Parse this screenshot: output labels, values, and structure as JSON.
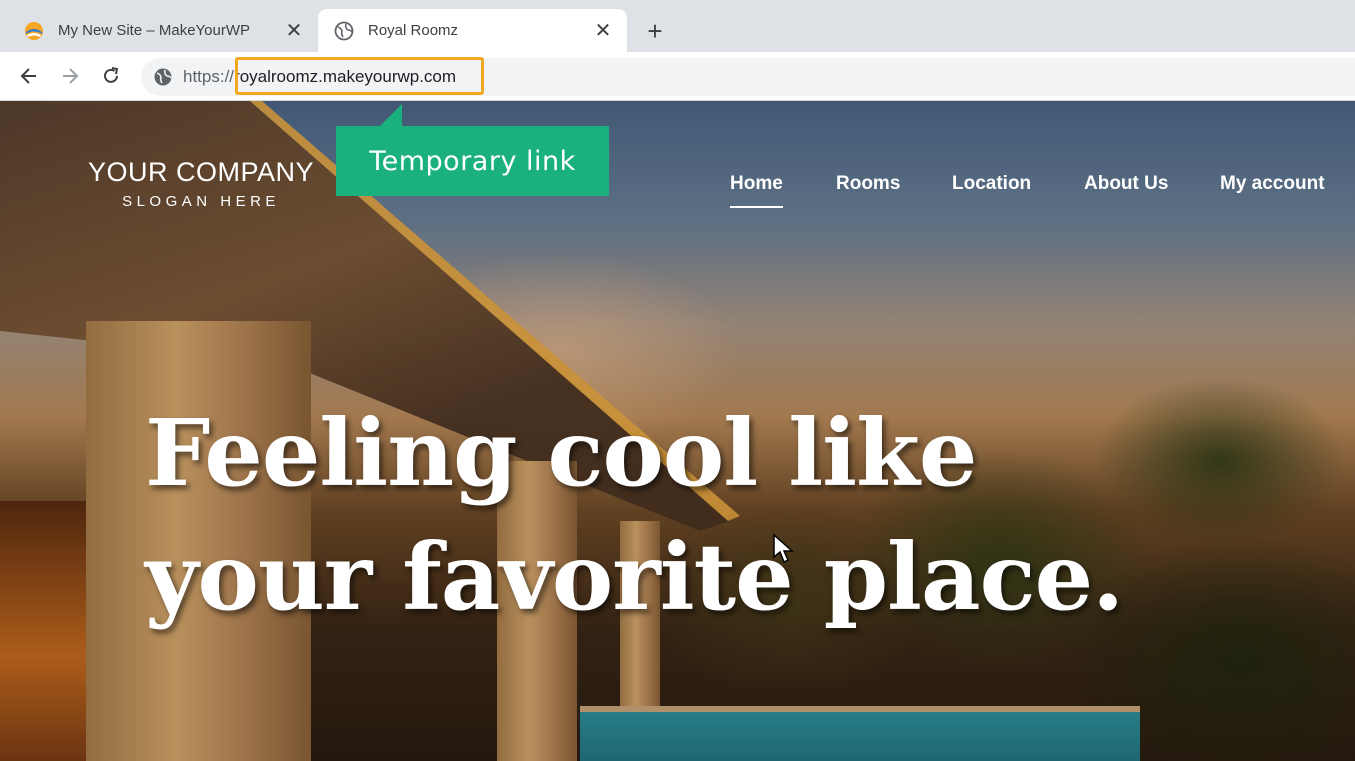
{
  "browser": {
    "tabs": [
      {
        "title": "My New Site – MakeYourWP",
        "active": false,
        "favicon": "makeyourwp-logo"
      },
      {
        "title": "Royal Roomz",
        "active": true,
        "favicon": "globe-icon"
      }
    ],
    "close_glyph": "✕",
    "new_tab_glyph": "+",
    "url_scheme": "https://",
    "url_host": "royalroomz.makeyourwp.com"
  },
  "annotation": {
    "callout_text": "Temporary link",
    "highlight_color": "#f3a81e",
    "callout_color": "#1bb17e"
  },
  "site": {
    "logo_name": "YOUR COMPANY",
    "logo_slogan": "SLOGAN HERE",
    "nav": [
      "Home",
      "Rooms",
      "Location",
      "About Us",
      "My account"
    ],
    "active_nav": "Home",
    "hero_line1": "Feeling cool like",
    "hero_line2": "your favorite place."
  }
}
